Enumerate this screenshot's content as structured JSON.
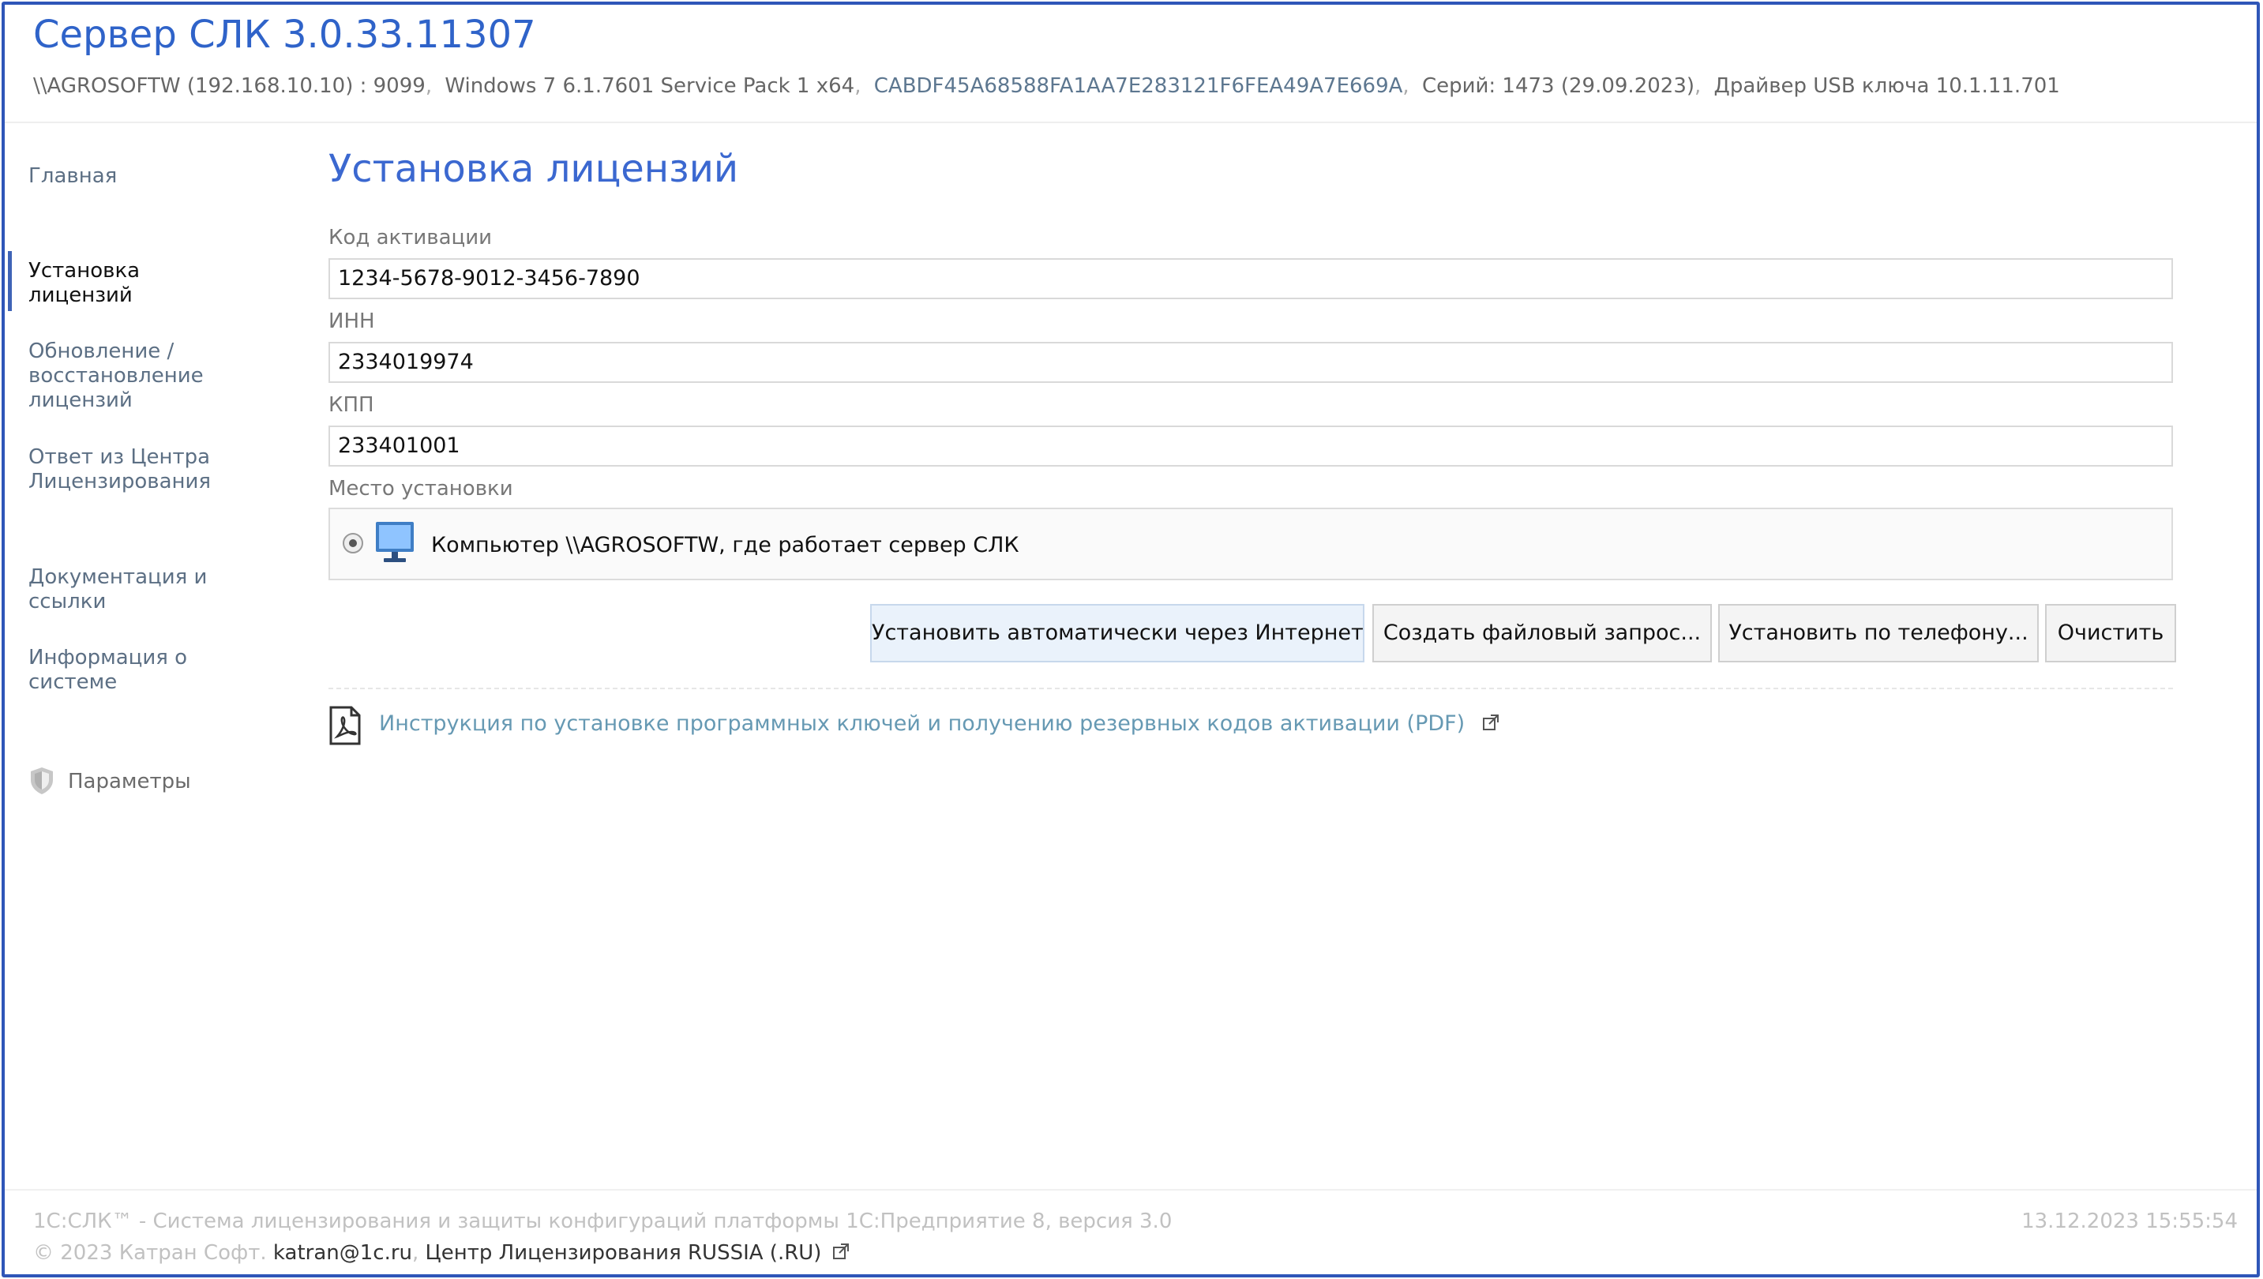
{
  "header": {
    "title": "Сервер СЛК 3.0.33.11307",
    "server": "\\\\AGROSOFTW (192.168.10.10) : 9099",
    "os": "Windows 7 6.1.7601 Service Pack 1 x64",
    "hash": "CABDF45A68588FA1AA7E283121F6FEA49A7E669A",
    "series": "Серий: 1473 (29.09.2023)",
    "driver": "Драйвер USB ключа 10.1.11.701",
    "separator": ","
  },
  "sidebar": {
    "items": [
      {
        "label": "Главная"
      },
      {
        "label": "Установка лицензий",
        "active": true
      },
      {
        "label": "Обновление / восстановление лицензий"
      },
      {
        "label": "Ответ из Центра Лицензирования"
      },
      {
        "label": "Документация и ссылки"
      },
      {
        "label": "Информация о системе"
      }
    ],
    "params_label": "Параметры"
  },
  "main": {
    "title": "Установка лицензий",
    "activation_label": "Код активации",
    "activation_value": "1234-5678-9012-3456-7890",
    "inn_label": "ИНН",
    "inn_value": "2334019974",
    "kpp_label": "КПП",
    "kpp_value": "233401001",
    "location_label": "Место установки",
    "location_option": "Компьютер \\\\AGROSOFTW, где работает сервер СЛК",
    "buttons": [
      {
        "label": "Установить автоматически через Интернет"
      },
      {
        "label": "Создать файловый запрос..."
      },
      {
        "label": "Установить по телефону..."
      },
      {
        "label": "Очистить"
      }
    ],
    "pdf_link": "Инструкция по установке программных ключей и получению резервных кодов активации (PDF)"
  },
  "footer": {
    "description": "1С:СЛК™ - Система лицензирования и защиты конфигураций платформы 1С:Предприятие 8, версия 3.0",
    "datetime": "13.12.2023 15:55:54",
    "copyright": "© 2023 Катран Софт.",
    "email": "katran@1c.ru",
    "separator": ",",
    "center_link": "Центр Лицензирования RUSSIA (.RU)"
  },
  "colors": {
    "accent": "#2f63c9",
    "border": "#2f56b8",
    "link": "#6699b3"
  },
  "icons": [
    "shield-icon",
    "computer-icon",
    "pdf-icon",
    "external-link-icon"
  ]
}
